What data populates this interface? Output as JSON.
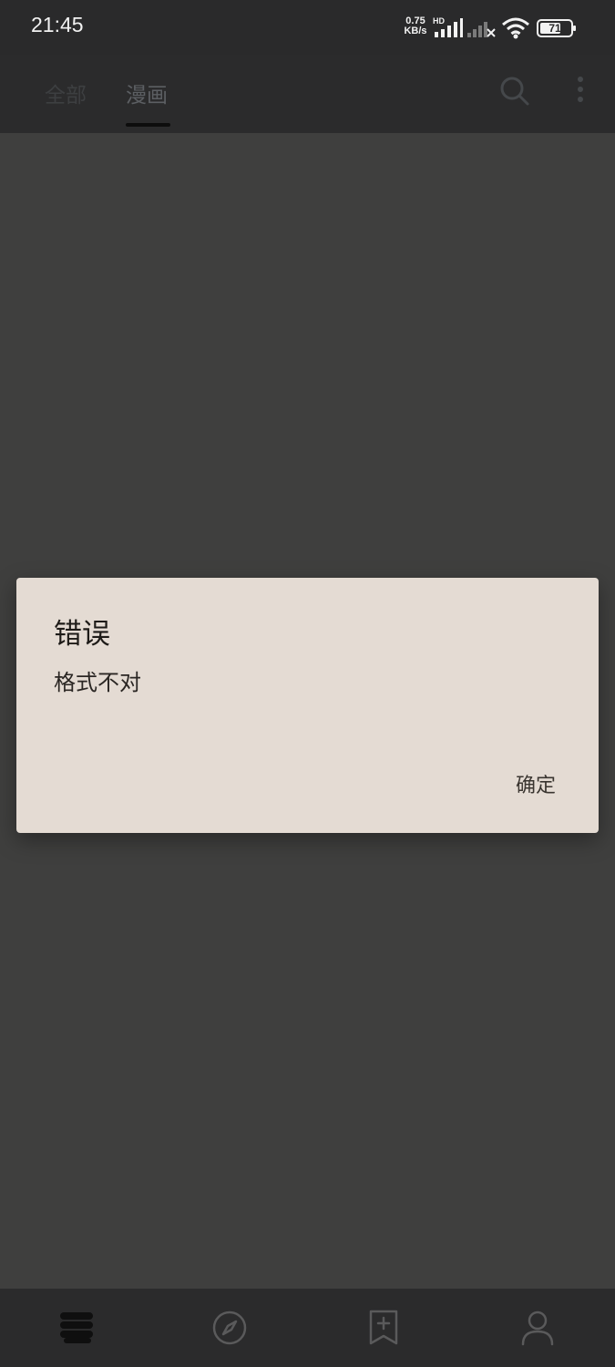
{
  "status_bar": {
    "time": "21:45",
    "net_speed_value": "0.75",
    "net_speed_unit": "KB/s",
    "network_badge": "HD",
    "battery_level": "71"
  },
  "app_bar": {
    "tabs": [
      {
        "label": "全部",
        "selected": false
      },
      {
        "label": "漫画",
        "selected": true
      }
    ],
    "icons": [
      "search-icon",
      "more-vertical-icon"
    ]
  },
  "dialog": {
    "title": "错误",
    "message": "格式不对",
    "confirm_label": "确定"
  },
  "bottom_nav": {
    "items": [
      "bookshelf-icon",
      "explore-icon",
      "bookmark-add-icon",
      "profile-icon"
    ]
  },
  "colors": {
    "dialog_background": "#e4dbd3",
    "scrim_background": "#3f3f3e",
    "bar_background": "#2b2b2c"
  }
}
